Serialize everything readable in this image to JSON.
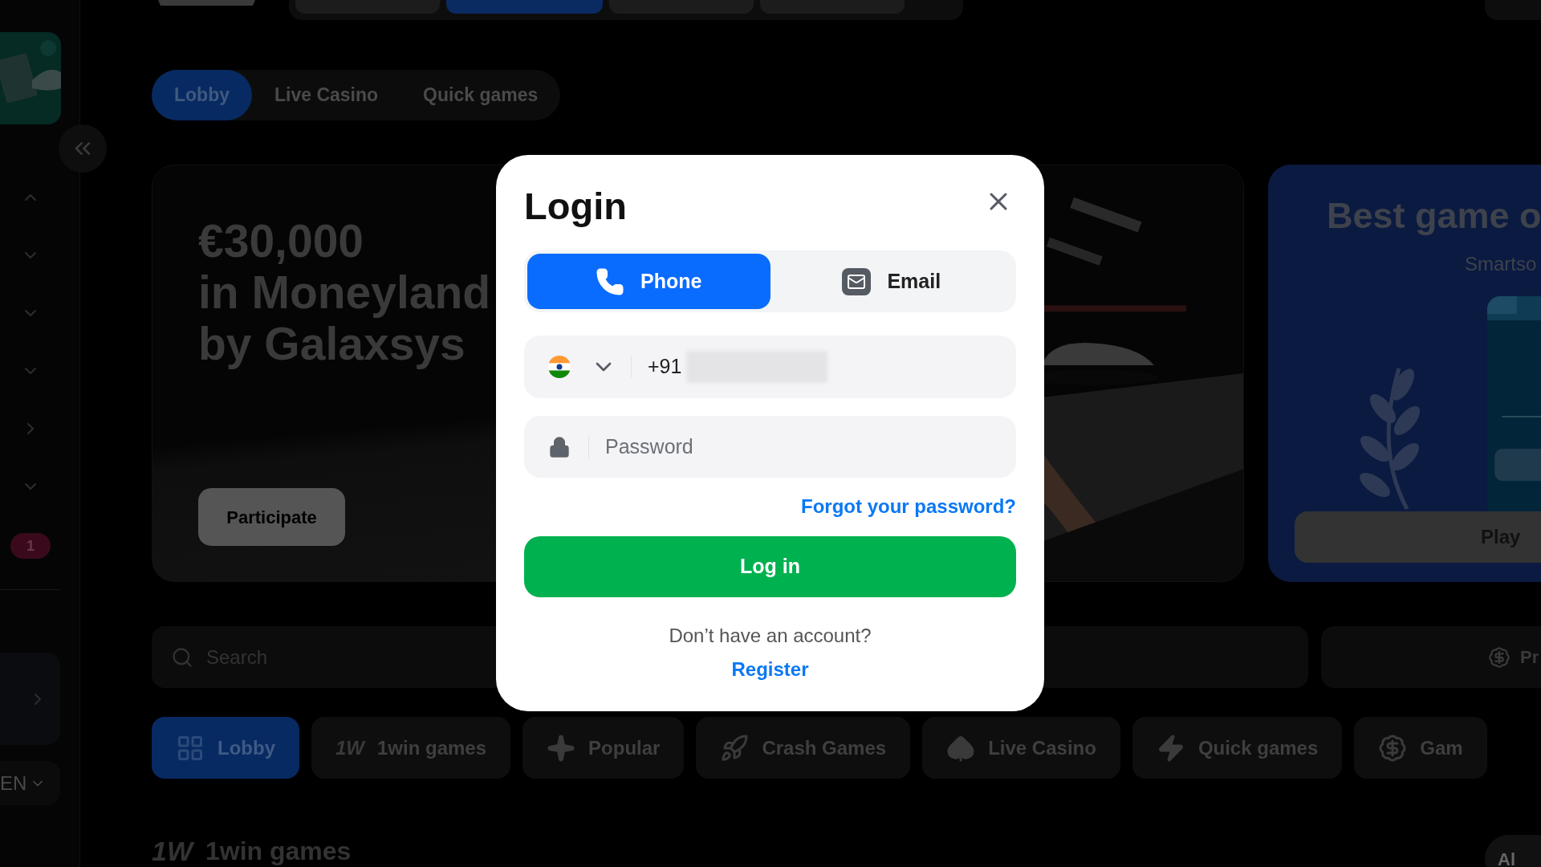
{
  "top_nav": [
    {
      "selected": false
    },
    {
      "selected": true
    },
    {
      "selected": false
    },
    {
      "selected": false
    }
  ],
  "sidebar": {
    "items": [
      {
        "kind": "up"
      },
      {
        "kind": "down"
      },
      {
        "kind": "down"
      },
      {
        "kind": "down"
      },
      {
        "kind": "right"
      },
      {
        "kind": "down"
      }
    ],
    "badge": "1",
    "language": "EN"
  },
  "top_tabs": [
    {
      "label": "Lobby",
      "selected": true
    },
    {
      "label": "Live Casino",
      "selected": false
    },
    {
      "label": "Quick games",
      "selected": false
    }
  ],
  "banners": [
    {
      "kind": "promo",
      "title_lines": [
        "€30,000",
        "in Moneyland",
        "by Galaxsys"
      ],
      "button": "Participate"
    },
    {
      "kind": "game",
      "title": "Best game o",
      "subtitle": "Smartso",
      "button": "Play"
    }
  ],
  "search": {
    "placeholder": "Search"
  },
  "promo_button": "Pr",
  "categories": [
    {
      "label": "Lobby",
      "kind": "grid",
      "selected": true
    },
    {
      "label": "1win games",
      "kind": "logo",
      "logo": "1W",
      "selected": false
    },
    {
      "label": "Popular",
      "kind": "star",
      "selected": false
    },
    {
      "label": "Crash Games",
      "kind": "rocket",
      "selected": false
    },
    {
      "label": "Live Casino",
      "kind": "spade",
      "selected": false
    },
    {
      "label": "Quick games",
      "kind": "bolt",
      "selected": false
    },
    {
      "label": "Gam",
      "kind": "dollar",
      "selected": false
    }
  ],
  "section": {
    "logo": "1W",
    "title": "1win games",
    "action": "Al"
  },
  "modal": {
    "title": "Login",
    "tabs": [
      {
        "label": "Phone",
        "kind": "phone",
        "selected": true
      },
      {
        "label": "Email",
        "kind": "email",
        "selected": false
      }
    ],
    "phone_code": "+91",
    "password_placeholder": "Password",
    "forgot": "Forgot your password?",
    "submit": "Log in",
    "prompt": "Don’t have an account?",
    "register": "Register"
  }
}
